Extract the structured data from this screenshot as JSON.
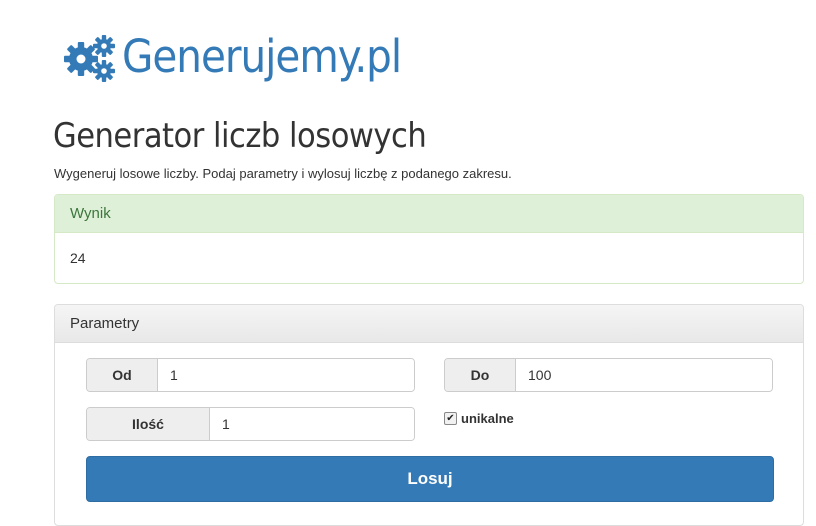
{
  "brand": {
    "text": "Generujemy.pl",
    "color": "#337ab7"
  },
  "page": {
    "title": "Generator liczb losowych",
    "description": "Wygeneruj losowe liczby. Podaj parametry i wylosuj liczbę z podanego zakresu."
  },
  "result": {
    "heading": "Wynik",
    "value": "24"
  },
  "params": {
    "heading": "Parametry",
    "od": {
      "label": "Od",
      "value": "1"
    },
    "do": {
      "label": "Do",
      "value": "100"
    },
    "ilosc": {
      "label": "Ilość",
      "value": "1"
    },
    "unique": {
      "label": "unikalne",
      "checked": true
    },
    "submit_label": "Losuj"
  },
  "colors": {
    "primary": "#337ab7",
    "success_bg": "#dff0d8",
    "success_text": "#3c763d"
  }
}
